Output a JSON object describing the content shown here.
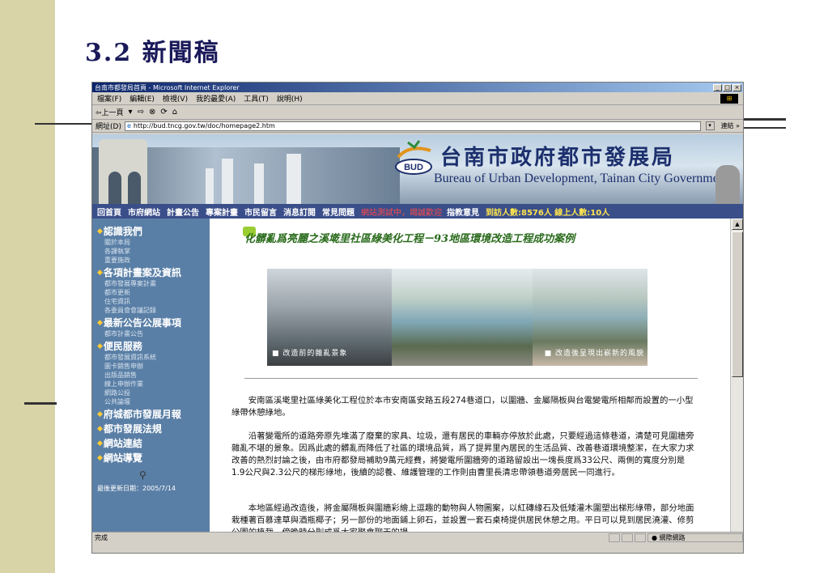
{
  "slide": {
    "title": "3.2 新聞稿"
  },
  "browser": {
    "window_title": "台南市都發局首頁 - Microsoft Internet Explorer",
    "menu": [
      "檔案(F)",
      "編輯(E)",
      "檢視(V)",
      "我的最愛(A)",
      "工具(T)",
      "說明(H)"
    ],
    "toolbar_back": "⇦上一頁",
    "address_label": "網址(D)",
    "address_url": "http://bud.tncg.gov.tw/doc/homepage2.htm",
    "go_label": "連結 »",
    "status": "完成",
    "zone": "網際網路"
  },
  "banner": {
    "agency_name": "台南市政府都市發展局",
    "agency_en": "Bureau of Urban Development, Tainan City Government",
    "logo_text": "BUD"
  },
  "nav": {
    "items": [
      "回首頁",
      "市府網站",
      "計畫公告",
      "專案計畫",
      "市民留言",
      "消息訂閱",
      "常見問題"
    ],
    "alert": "網站測試中，竭誠歡迎",
    "feedback": "指教意見",
    "visitors": "到訪人數:8576人 線上人數:10人"
  },
  "sidebar": {
    "sections": [
      {
        "title": "認識我們",
        "items": [
          "關於本局",
          "各課執掌",
          "重要施政"
        ]
      },
      {
        "title": "各項計畫案及資訊",
        "items": [
          "都市發展專案計畫",
          "都市更新",
          "住宅資訊",
          "各委員會會議記錄"
        ]
      },
      {
        "title": "最新公告公展事項",
        "items": [
          "都市計畫公告"
        ]
      },
      {
        "title": "便民服務",
        "items": [
          "都市發展資訊系統",
          "圖卡銷售申辦",
          "出版品銷售",
          "線上申辦作業",
          "網路公投",
          "公共論壇"
        ]
      },
      {
        "title": "府城都市發展月報",
        "items": []
      },
      {
        "title": "都市發展法規",
        "items": []
      },
      {
        "title": "網站連結",
        "items": []
      },
      {
        "title": "網站導覽",
        "items": []
      }
    ],
    "updated": "最後更新日期：2005/7/14"
  },
  "article": {
    "title": "化髒亂爲亮麗之溪墘里社區綠美化工程－93地區環境改造工程成功案例",
    "caption_before": "■ 改造前的雜亂景象",
    "caption_after": "■ 改造後呈現出嶄新的風貌",
    "paragraphs": [
      "安南區溪墘里社區綠美化工程位於本市安南區安路五段274巷道口，以圍牆、金屬隔板與台電變電所相鄰而設置的一小型綠帶休憩綠地。",
      "沿著變電所的道路旁原先堆滿了廢棄的家具、垃圾，還有居民的車輛亦停放於此處，只要經過這條巷道，清楚可見圍牆旁雜亂不堪的景象。因爲此處的髒亂而降低了社區的環境品質，爲了提昇里內居民的生活品質、改善巷道環境整潔，在大家力求改善的熱烈討論之後，由市府都發局補助9萬元經費，將變電所圍牆旁的道路留設出一塊長度爲33公尺、兩側的寬度分別是1.9公尺與2.3公尺的梯形綠地，後續的認養、維護管理的工作則由曹里長清忠帶領巷道旁居民一同進行。",
      "本地區經過改造後，將金屬隔板與圍牆彩繪上逗趣的動物與人物圖案，以紅磚緣石及低矮灌木圍塑出梯形綠帶，部分地面栽種著百慕達草與酒瓶椰子；另一部份的地面鋪上卵石，並設置一套石桌椅提供居民休憩之用。平日可以見到居民澆灌、修剪公園的植栽，傍晚時分則成爲大家聚會聊天的場"
    ]
  }
}
